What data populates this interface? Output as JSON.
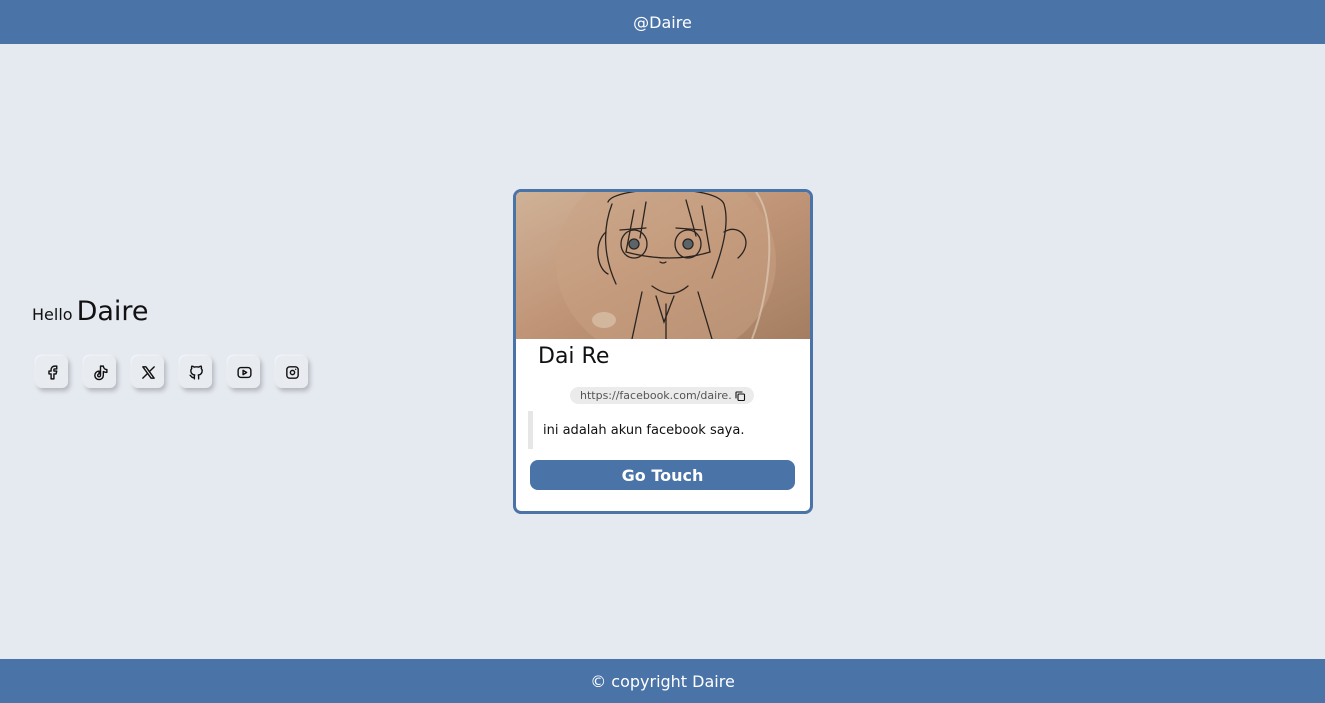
{
  "header": {
    "title": "@Daire"
  },
  "greeting": {
    "hello": "Hello",
    "name": "Daire"
  },
  "socials": [
    {
      "name": "facebook",
      "icon": "facebook-icon"
    },
    {
      "name": "tiktok",
      "icon": "tiktok-icon"
    },
    {
      "name": "x",
      "icon": "x-icon"
    },
    {
      "name": "github",
      "icon": "github-icon"
    },
    {
      "name": "youtube",
      "icon": "youtube-icon"
    },
    {
      "name": "instagram",
      "icon": "instagram-icon"
    }
  ],
  "card": {
    "title": "Dai Re",
    "url": "https://facebook.com/daire.",
    "description": "ini adalah akun facebook saya.",
    "button_label": "Go Touch"
  },
  "footer": {
    "text": "© copyright Daire"
  },
  "colors": {
    "accent": "#4a73a8",
    "background": "#e5e9f0"
  }
}
